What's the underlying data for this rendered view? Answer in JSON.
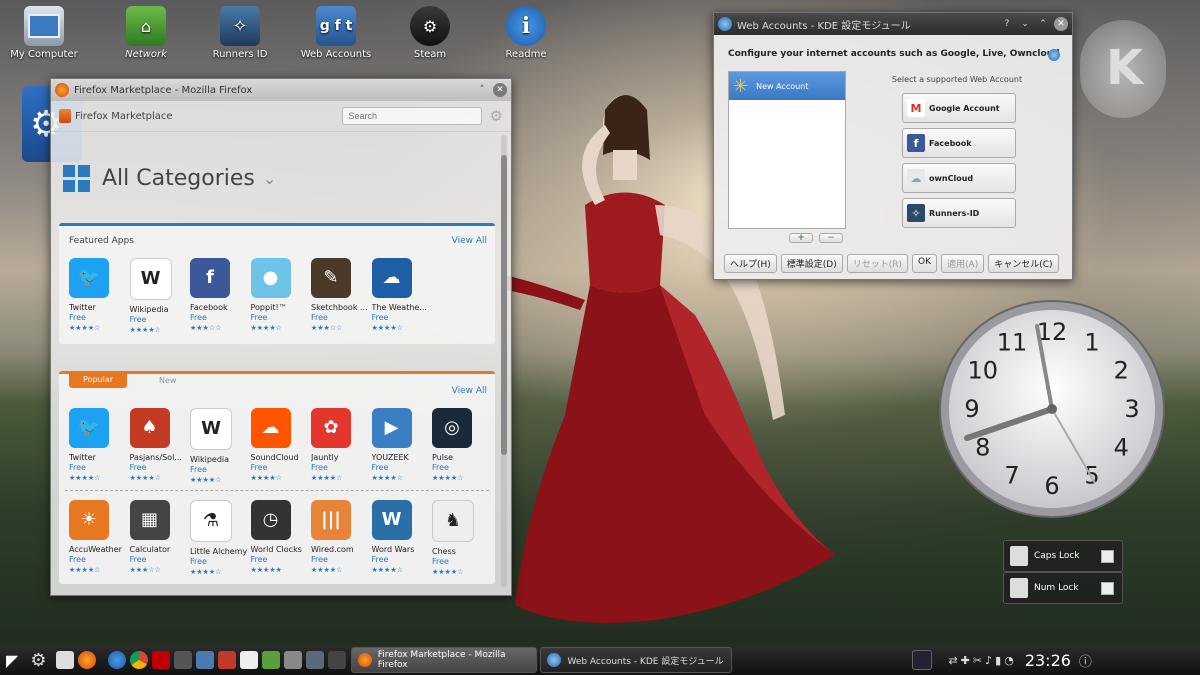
{
  "desktop_icons": [
    {
      "label": "My Computer",
      "icon": "monitor-icon"
    },
    {
      "label": "Network",
      "icon": "network-folder-icon"
    },
    {
      "label": "Runners ID",
      "icon": "runners-id-icon"
    },
    {
      "label": "Web Accounts",
      "icon": "web-accounts-icon"
    },
    {
      "label": "Steam",
      "icon": "steam-icon"
    },
    {
      "label": "Readme",
      "icon": "info-icon"
    }
  ],
  "firefox": {
    "title": "Firefox Marketplace - Mozilla Firefox",
    "toolbar_name": "Firefox Marketplace",
    "search_placeholder": "Search",
    "heading": "All Categories",
    "featured": {
      "title": "Featured Apps",
      "view_all": "View All",
      "apps": [
        {
          "name": "Twitter",
          "price": "Free",
          "stars": "★★★★☆",
          "color": "#1da1f2",
          "glyph": "🐦"
        },
        {
          "name": "Wikipedia",
          "price": "Free",
          "stars": "★★★★☆",
          "color": "#ffffff",
          "glyph": "W"
        },
        {
          "name": "Facebook",
          "price": "Free",
          "stars": "★★★☆☆",
          "color": "#3b5998",
          "glyph": "f"
        },
        {
          "name": "Poppit!™",
          "price": "Free",
          "stars": "★★★★☆",
          "color": "#6cc4e8",
          "glyph": "●"
        },
        {
          "name": "Sketchbook ...",
          "price": "Free",
          "stars": "★★★☆☆",
          "color": "#4b3a2a",
          "glyph": "✎"
        },
        {
          "name": "The Weathe...",
          "price": "Free",
          "stars": "★★★★☆",
          "color": "#1f5fa8",
          "glyph": "☁"
        }
      ]
    },
    "popular": {
      "tab_popular": "Popular",
      "tab_new": "New",
      "view_all": "View All",
      "row1": [
        {
          "name": "Twitter",
          "price": "Free",
          "stars": "★★★★☆",
          "color": "#1da1f2",
          "glyph": "🐦"
        },
        {
          "name": "Pasjans/Sol...",
          "price": "Free",
          "stars": "★★★★☆",
          "color": "#c23b22",
          "glyph": "♠"
        },
        {
          "name": "Wikipedia",
          "price": "Free",
          "stars": "★★★★☆",
          "color": "#ffffff",
          "glyph": "W"
        },
        {
          "name": "SoundCloud",
          "price": "Free",
          "stars": "★★★★☆",
          "color": "#ff5500",
          "glyph": "☁"
        },
        {
          "name": "Jauntly",
          "price": "Free",
          "stars": "★★★★☆",
          "color": "#e3372c",
          "glyph": "✿"
        },
        {
          "name": "YOUZEEK",
          "price": "Free",
          "stars": "★★★★☆",
          "color": "#3a7fc4",
          "glyph": "▶"
        },
        {
          "name": "Pulse",
          "price": "Free",
          "stars": "★★★★☆",
          "color": "#1a2a3a",
          "glyph": "◎"
        }
      ],
      "row2": [
        {
          "name": "AccuWeather",
          "price": "Free",
          "stars": "★★★★☆",
          "color": "#e87722",
          "glyph": "☀"
        },
        {
          "name": "Calculator",
          "price": "Free",
          "stars": "★★★☆☆",
          "color": "#444444",
          "glyph": "▦"
        },
        {
          "name": "Little Alchemy",
          "price": "Free",
          "stars": "★★★★☆",
          "color": "#ffffff",
          "glyph": "⚗"
        },
        {
          "name": "World Clocks",
          "price": "Free",
          "stars": "★★★★★",
          "color": "#333333",
          "glyph": "◷"
        },
        {
          "name": "Wired.com",
          "price": "Free",
          "stars": "★★★★☆",
          "color": "#e8833a",
          "glyph": "|||"
        },
        {
          "name": "Word Wars",
          "price": "Free",
          "stars": "★★★★☆",
          "color": "#2a6fa8",
          "glyph": "W"
        },
        {
          "name": "Chess",
          "price": "Free",
          "stars": "★★★★☆",
          "color": "#eeeeee",
          "glyph": "♞"
        }
      ]
    }
  },
  "kde": {
    "title": "Web Accounts - KDE 設定モジュール",
    "heading": "Configure your internet accounts such as Google, Live, Owncloud",
    "new_account": "New Account",
    "select_label": "Select a supported Web Account",
    "accounts": [
      {
        "label": "Google Account",
        "color": "#ffffff",
        "glyph": "M",
        "glyph_color": "#d93025"
      },
      {
        "label": "Facebook",
        "color": "#3b5998",
        "glyph": "f",
        "glyph_color": "#ffffff"
      },
      {
        "label": "ownCloud",
        "color": "#e8e8e8",
        "glyph": "☁",
        "glyph_color": "#7aa8c8"
      },
      {
        "label": "Runners-ID",
        "color": "#2a4a6a",
        "glyph": "✧",
        "glyph_color": "#ffffff"
      }
    ],
    "buttons": {
      "help": "ヘルプ(H)",
      "defaults": "標準設定(D)",
      "reset": "リセット(R)",
      "ok": "OK",
      "apply": "適用(A)",
      "cancel": "キャンセル(C)"
    }
  },
  "clock": {
    "numbers": [
      "12",
      "1",
      "2",
      "3",
      "4",
      "5",
      "6",
      "7",
      "8",
      "9",
      "10",
      "11"
    ]
  },
  "locks": {
    "caps": "Caps Lock",
    "num": "Num Lock"
  },
  "taskbar": {
    "tasks": [
      {
        "label": "Firefox Marketplace - Mozilla Firefox",
        "active": true
      },
      {
        "label": "Web Accounts - KDE 設定モジュール",
        "active": false
      }
    ],
    "time": "23:26"
  }
}
